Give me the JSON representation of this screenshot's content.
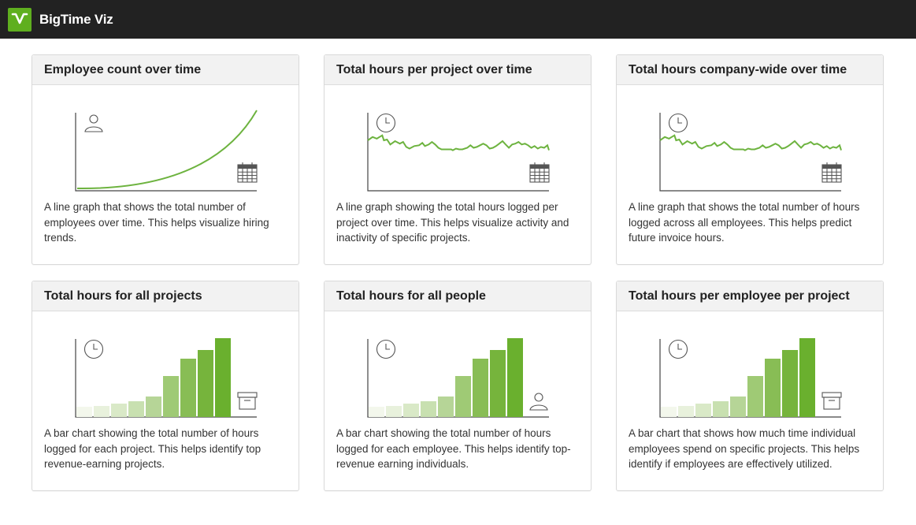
{
  "app": {
    "title": "BigTime Viz",
    "logo_icon": "bigtime-logo-icon",
    "accent": "#6db33f"
  },
  "cards": [
    {
      "title": "Employee count over time",
      "viz": "line-growth",
      "y_icon": "person-icon",
      "x_icon": "calendar-icon",
      "description": "A line graph that shows the total number of employees over time. This helps visualize hiring trends."
    },
    {
      "title": "Total hours per project over time",
      "viz": "line-flat",
      "y_icon": "clock-icon",
      "x_icon": "calendar-icon",
      "description": "A line graph showing the total hours logged per project over time. This helps visualize activity and inactivity of specific projects."
    },
    {
      "title": "Total hours company-wide over time",
      "viz": "line-flat",
      "y_icon": "clock-icon",
      "x_icon": "calendar-icon",
      "description": "A line graph that shows the total number of hours logged across all employees. This helps predict future invoice hours."
    },
    {
      "title": "Total hours for all projects",
      "viz": "bar",
      "y_icon": "clock-icon",
      "x_icon": "box-icon",
      "description": "A bar chart showing the total number of hours logged for each project. This helps identify top revenue-earning projects."
    },
    {
      "title": "Total hours for all people",
      "viz": "bar",
      "y_icon": "clock-icon",
      "x_icon": "person-icon",
      "description": "A bar chart showing the total number of hours logged for each employee. This helps identify top-revenue earning individuals."
    },
    {
      "title": "Total hours per employee per project",
      "viz": "bar",
      "y_icon": "clock-icon",
      "x_icon": "box-icon",
      "description": "A bar chart that shows how much time individual employees spend on specific projects. This helps identify if employees are effectively utilized."
    }
  ]
}
